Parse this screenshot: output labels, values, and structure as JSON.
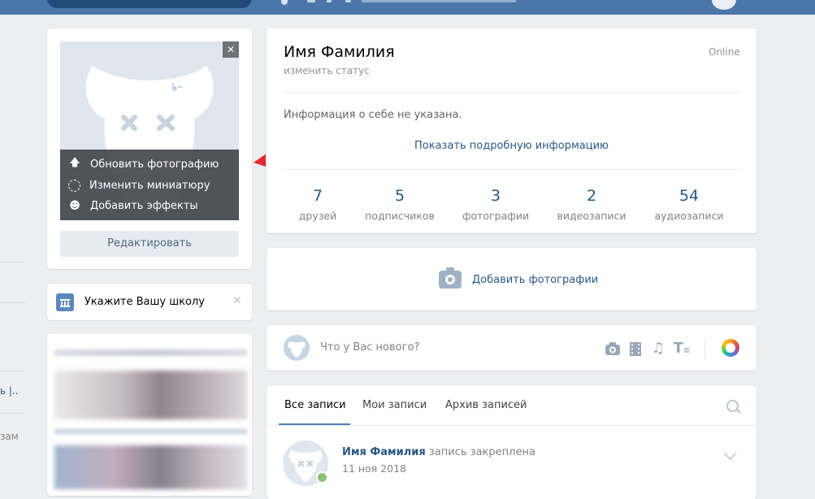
{
  "profile": {
    "name": "Имя Фамилия",
    "change_status": "изменить статус",
    "online": "Online",
    "about": "Информация о себе не указана.",
    "show_more": "Показать подробную информацию"
  },
  "photo_menu": {
    "update": "Обновить фотографию",
    "thumbnail": "Изменить миниатюру",
    "effects": "Добавить эффекты",
    "close": "✕",
    "edit_button": "Редактировать"
  },
  "school": {
    "label": "Укажите Вашу школу",
    "close": "✕"
  },
  "counters": [
    {
      "value": "7",
      "label": "друзей"
    },
    {
      "value": "5",
      "label": "подписчиков"
    },
    {
      "value": "3",
      "label": "фотографии"
    },
    {
      "value": "2",
      "label": "видеозаписи"
    },
    {
      "value": "54",
      "label": "аудиозаписи"
    }
  ],
  "add_photos": "Добавить фотографии",
  "composer": {
    "placeholder": "Что у Вас нового?"
  },
  "tabs": [
    "Все записи",
    "Мои записи",
    "Архив записей"
  ],
  "post": {
    "author": "Имя Фамилия",
    "pinned": "запись закреплена",
    "date": "11 ноя 2018"
  },
  "left_nav": {
    "item1": "ь |..",
    "item2": "зам"
  },
  "colors": {
    "header": "#4a76a8",
    "link": "#2a5885",
    "accent_arrow": "#e8262b",
    "online": "#8ac176"
  }
}
